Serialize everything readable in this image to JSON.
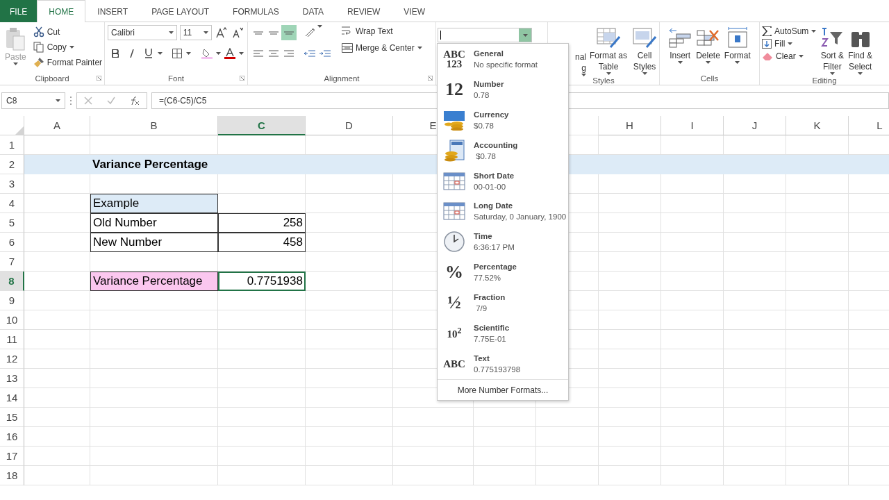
{
  "tabs": [
    {
      "label": "FILE",
      "kind": "file",
      "selected": false
    },
    {
      "label": "HOME",
      "kind": "tab",
      "selected": true
    },
    {
      "label": "INSERT",
      "kind": "tab",
      "selected": false
    },
    {
      "label": "PAGE LAYOUT",
      "kind": "tab",
      "selected": false
    },
    {
      "label": "FORMULAS",
      "kind": "tab",
      "selected": false
    },
    {
      "label": "DATA",
      "kind": "tab",
      "selected": false
    },
    {
      "label": "REVIEW",
      "kind": "tab",
      "selected": false
    },
    {
      "label": "VIEW",
      "kind": "tab",
      "selected": false
    }
  ],
  "clipboard": {
    "label": "Clipboard",
    "paste": "Paste",
    "cut": "Cut",
    "copy": "Copy",
    "format_painter": "Format Painter"
  },
  "font": {
    "label": "Font",
    "font_name": "Calibri",
    "font_size": "11"
  },
  "alignment": {
    "label": "Alignment",
    "bottom_align_selected": true,
    "wrap_text": "Wrap Text",
    "merge": "Merge & Center"
  },
  "number_format": {
    "expanded": true
  },
  "styles": {
    "label": "Styles",
    "conditional": [
      "nal",
      "g"
    ],
    "format_as_table": [
      "Format as",
      "Table"
    ],
    "cell_styles": [
      "Cell",
      "Styles"
    ]
  },
  "cells_group": {
    "label": "Cells",
    "insert": "Insert",
    "delete": "Delete",
    "format": "Format"
  },
  "editing": {
    "label": "Editing",
    "autosum": "AutoSum",
    "fill": "Fill",
    "clear": "Clear",
    "sort": [
      "Sort &",
      "Filter"
    ],
    "find": [
      "Find &",
      "Select"
    ]
  },
  "name_box": "C8",
  "formula": "=(C6-C5)/C5",
  "columns": [
    {
      "label": "A",
      "selected": false
    },
    {
      "label": "B",
      "selected": false
    },
    {
      "label": "C",
      "selected": true
    },
    {
      "label": "D",
      "selected": false
    },
    {
      "label": "E",
      "selected": false
    },
    {
      "kind": "covered"
    },
    {
      "kind": "covered"
    },
    {
      "label": "H",
      "selected": false
    },
    {
      "label": "I",
      "selected": false
    },
    {
      "label": "J",
      "selected": false
    },
    {
      "label": "K",
      "selected": false
    },
    {
      "label": "L",
      "selected": false
    }
  ],
  "rows": [
    {
      "number": "1",
      "selected": false
    },
    {
      "number": "2",
      "selected": false,
      "kind": "band",
      "b": {
        "text": "Variance Percentage",
        "kind": "title"
      }
    },
    {
      "number": "3",
      "selected": false
    },
    {
      "number": "4",
      "selected": false,
      "b": {
        "text": "Example",
        "kind": "header"
      }
    },
    {
      "number": "5",
      "selected": false,
      "b": {
        "text": "Old Number",
        "kind": "boxed"
      },
      "c": {
        "text": "258",
        "kind": "number"
      }
    },
    {
      "number": "6",
      "selected": false,
      "b": {
        "text": "New Number",
        "kind": "boxed"
      },
      "c": {
        "text": "458",
        "kind": "number"
      }
    },
    {
      "number": "7",
      "selected": false
    },
    {
      "number": "8",
      "selected": true,
      "b": {
        "text": "Variance Percentage",
        "kind": "highlight"
      },
      "c": {
        "text": "0.7751938",
        "kind": "number",
        "selected": true
      }
    },
    {
      "number": "9",
      "selected": false
    },
    {
      "number": "10",
      "selected": false
    },
    {
      "number": "11",
      "selected": false
    },
    {
      "number": "12",
      "selected": false
    },
    {
      "number": "13",
      "selected": false
    },
    {
      "number": "14",
      "selected": false
    },
    {
      "number": "15",
      "selected": false
    },
    {
      "number": "16",
      "selected": false
    },
    {
      "number": "17",
      "selected": false
    },
    {
      "number": "18",
      "selected": false
    }
  ],
  "format_menu": {
    "items": [
      {
        "kind": "glyph",
        "glyph": [
          "ABC",
          "123"
        ],
        "label": "General",
        "sample": "No specific format"
      },
      {
        "kind": "glyph",
        "glyph": [
          "12"
        ],
        "label": "Number",
        "sample": "0.78"
      },
      {
        "kind": "currency",
        "label": "Currency",
        "sample": "$0.78"
      },
      {
        "kind": "accounting",
        "label": "Accounting",
        "sample": " $0.78"
      },
      {
        "kind": "date",
        "label": "Short Date",
        "sample": "00-01-00"
      },
      {
        "kind": "date",
        "label": "Long Date",
        "sample": "Saturday, 0 January, 1900"
      },
      {
        "kind": "time",
        "label": "Time",
        "sample": "6:36:17 PM"
      },
      {
        "kind": "glyph",
        "glyph": [
          "%"
        ],
        "label": "Percentage",
        "sample": "77.52%"
      },
      {
        "kind": "glyph",
        "glyph": [
          "½"
        ],
        "label": "Fraction",
        "sample": " 7/9"
      },
      {
        "kind": "glyph",
        "glyph": [
          "10$^{2}$"
        ],
        "label": "Scientific",
        "sample": "7.75E-01"
      },
      {
        "kind": "glyph",
        "glyph": [
          "ABC"
        ],
        "label": "Text",
        "sample": "0.775193798"
      }
    ],
    "more": "More Number Formats..."
  }
}
